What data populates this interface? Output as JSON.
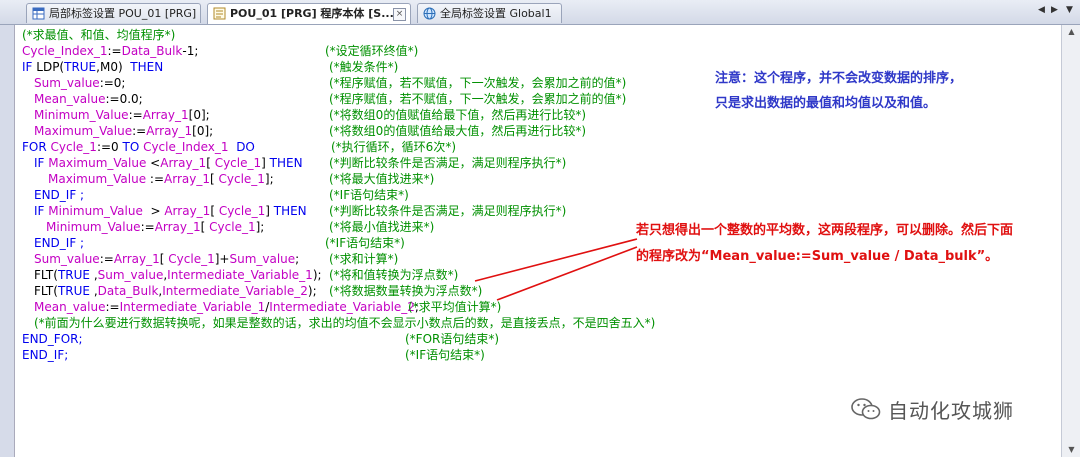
{
  "tabs": [
    {
      "label": "局部标签设置 POU_01 [PRG]",
      "active": false
    },
    {
      "label": "POU_01 [PRG] 程序本体 [S...",
      "active": true,
      "close": "×"
    },
    {
      "label": "全局标签设置 Global1",
      "active": false
    }
  ],
  "nav_arrows": {
    "left": "◀",
    "right": "▶",
    "menu": "▼"
  },
  "scroll": {
    "up": "▲",
    "down": "▼"
  },
  "code": [
    {
      "text": "(*求最值、和值、均值程序*)"
    },
    {
      "pre": "Cycle_Index_1:=Data_Bulk-1;",
      "comment": "(*设定循环终值*)"
    },
    {
      "pre": "IF LDP(TRUE,M0)  THEN",
      "comment": "(*触发条件*)"
    },
    {
      "pre": "Sum_value:=0;",
      "comment": "(*程序赋值，若不赋值，下一次触发，会累加之前的值*)"
    },
    {
      "pre": "Mean_value:=0.0;",
      "comment": "(*程序赋值，若不赋值，下一次触发，会累加之前的值*)"
    },
    {
      "pre": "Minimum_Value:=Array_1[0];",
      "comment": "(*将数组0的值赋值给最下值，然后再进行比较*)"
    },
    {
      "pre": "Maximum_Value:=Array_1[0];",
      "comment": "(*将数组0的值赋值给最大值，然后再进行比较*)"
    },
    {
      "pre": "FOR Cycle_1:=0 TO Cycle_Index_1  DO",
      "comment": "(*执行循环，循环6次*)"
    },
    {
      "pre": "IF Maximum_Value <Array_1[ Cycle_1] THEN",
      "comment": "(*判断比较条件是否满足，满足则程序执行*)"
    },
    {
      "pre": "Maximum_Value :=Array_1[ Cycle_1];",
      "comment": "(*将最大值找进来*)"
    },
    {
      "pre": "END_IF ;",
      "comment": "(*IF语句结束*)"
    },
    {
      "pre": "IF Minimum_Value  > Array_1[ Cycle_1] THEN",
      "comment": "(*判断比较条件是否满足，满足则程序执行*)"
    },
    {
      "pre": "Minimum_Value:=Array_1[ Cycle_1];",
      "comment": "(*将最小值找进来*)"
    },
    {
      "pre": "END_IF ;",
      "comment": "(*IF语句结束*)"
    },
    {
      "pre": "Sum_value:=Array_1[ Cycle_1]+Sum_value;",
      "comment": "(*求和计算*)"
    },
    {
      "pre": "FLT(TRUE ,Sum_value,Intermediate_Variable_1);",
      "comment": "(*将和值转换为浮点数*)"
    },
    {
      "pre": "FLT(TRUE ,Data_Bulk,Intermediate_Variable_2);",
      "comment": "(*将数据数量转换为浮点数*)"
    },
    {
      "pre": "Mean_value:=Intermediate_Variable_1/Intermediate_Variable_2;",
      "comment": "(*求平均值计算*)"
    },
    {
      "text": "(*前面为什么要进行数据转换呢，如果是整数的话，求出的均值不会显示小数点后的数，是直接丢点，不是四舍五入*)"
    },
    {
      "pre": "END_FOR;",
      "comment": "(*FOR语句结束*)"
    },
    {
      "pre": "END_IF;",
      "comment": "(*IF语句结束*)"
    }
  ],
  "notes": {
    "blue_line1": "注意：这个程序，并不会改变数据的排序，",
    "blue_line2": "只是求出数据的最值和均值以及和值。",
    "red_line1": "若只想得出一个整数的平均数，这两段程序，可以删除。然后下面",
    "red_line2": "的程序改为“Mean_value:=Sum_value / Data_bulk”。"
  },
  "watermark": "自动化攻城狮",
  "colors": {
    "keyword": "#0000ee",
    "identifier": "#c300c3",
    "comment": "#009000",
    "note_blue": "#2f38c8",
    "note_red": "#e01010"
  }
}
